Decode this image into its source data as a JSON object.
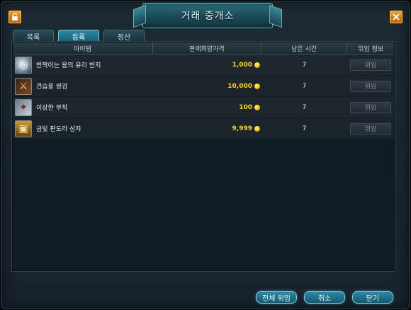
{
  "window": {
    "title": "거래 중개소"
  },
  "tabs": [
    {
      "label": "목록",
      "active": false
    },
    {
      "label": "등록",
      "active": true
    },
    {
      "label": "정산",
      "active": false
    }
  ],
  "table": {
    "headers": {
      "item": "아이템",
      "price": "판매희망가격",
      "time": "남은 시간",
      "info": "위임 정보"
    },
    "rows": [
      {
        "name": "반짝이는 용의 유리 반지",
        "icon": "ring-icon",
        "price": "1,000",
        "time": "7",
        "action": "위임"
      },
      {
        "name": "견습용 쌍검",
        "icon": "dual-swords-icon",
        "price": "10,000",
        "time": "7",
        "action": "위임"
      },
      {
        "name": "이상한 부적",
        "icon": "charm-icon",
        "price": "100",
        "time": "7",
        "action": "위임"
      },
      {
        "name": "금빛 판도라 상자",
        "icon": "treasure-chest-icon",
        "price": "9,999",
        "time": "7",
        "action": "위임"
      }
    ]
  },
  "footer": {
    "delegate_all": "전체 위임",
    "cancel": "취소",
    "close": "닫기"
  },
  "colors": {
    "gold_price": "#ffd21f",
    "accent": "#2b86a3",
    "corner_button": "#f6a325"
  }
}
